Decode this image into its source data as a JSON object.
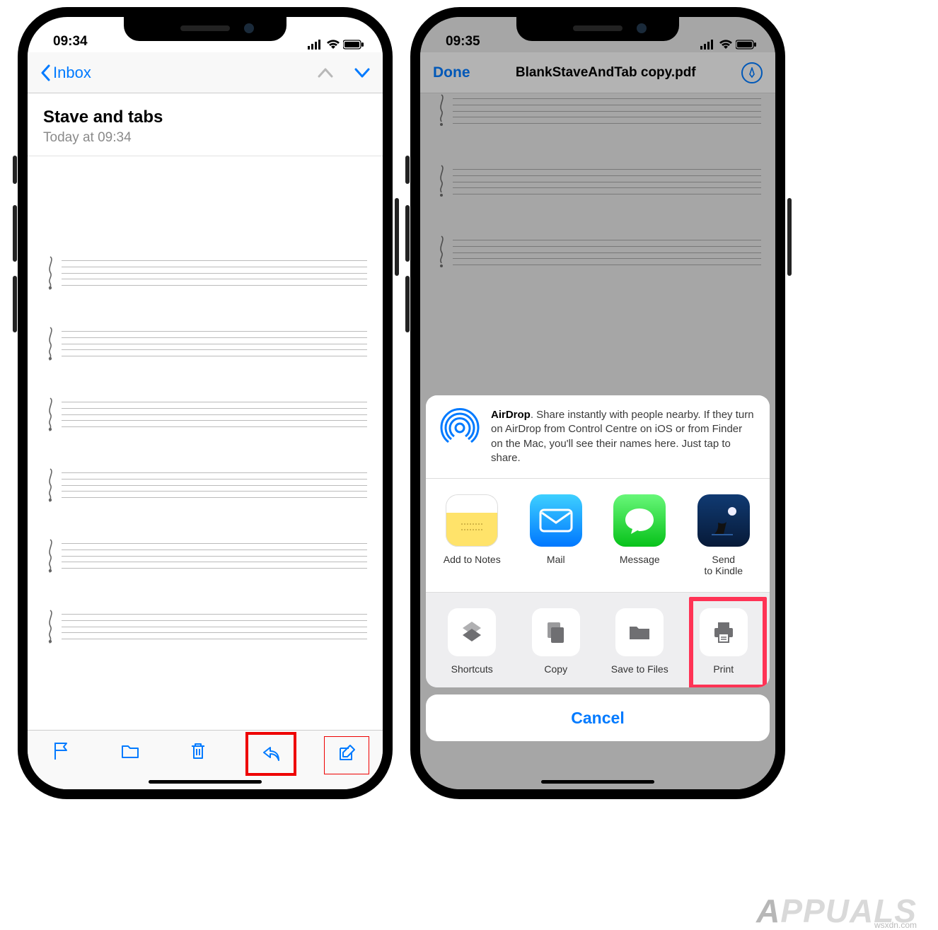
{
  "left": {
    "status_time": "09:34",
    "back_label": "Inbox",
    "subject": "Stave and tabs",
    "date_line": "Today at 09:34"
  },
  "right": {
    "status_time": "09:35",
    "done_label": "Done",
    "pdf_title": "BlankStaveAndTab copy.pdf",
    "airdrop_bold": "AirDrop",
    "airdrop_text": ". Share instantly with people nearby. If they turn on AirDrop from Control Centre on iOS or from Finder on the Mac, you'll see their names here. Just tap to share.",
    "apps": [
      {
        "label": "Add to Notes"
      },
      {
        "label": "Mail"
      },
      {
        "label": "Message"
      },
      {
        "label": "Send to Kindle"
      }
    ],
    "actions": [
      {
        "label": "Shortcuts"
      },
      {
        "label": "Copy"
      },
      {
        "label": "Save to Files"
      },
      {
        "label": "Print"
      }
    ],
    "cancel_label": "Cancel"
  },
  "watermark_source": "wsxdn.com"
}
